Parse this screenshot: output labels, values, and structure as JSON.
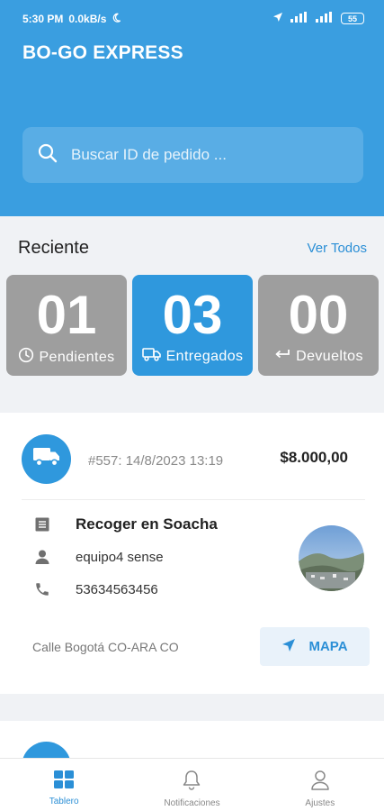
{
  "status_bar": {
    "time": "5:30 PM",
    "speed": "0.0kB/s",
    "battery": "55"
  },
  "header": {
    "title": "BO-GO EXPRESS"
  },
  "search": {
    "placeholder": "Buscar ID de pedido ..."
  },
  "recent": {
    "title": "Reciente",
    "view_all": "Ver Todos",
    "tiles": [
      {
        "count": "01",
        "label": "Pendientes",
        "icon": "clock-icon",
        "active": false
      },
      {
        "count": "03",
        "label": "Entregados",
        "icon": "truck-icon",
        "active": true
      },
      {
        "count": "00",
        "label": "Devueltos",
        "icon": "return-arrow-icon",
        "active": false
      }
    ]
  },
  "order": {
    "id_date": "#557: 14/8/2023 13:19",
    "amount": "$8.000,00",
    "title": "Recoger en Soacha",
    "customer": "equipo4 sense",
    "phone": "53634563456",
    "address": "Calle Bogotá CO-ARA CO",
    "map_button": "MAPA"
  },
  "bottom_nav": [
    {
      "label": "Tablero",
      "icon": "dashboard-grid-icon",
      "active": true
    },
    {
      "label": "Notificaciones",
      "icon": "bell-icon",
      "active": false
    },
    {
      "label": "Ajustes",
      "icon": "person-icon",
      "active": false
    }
  ],
  "colors": {
    "primary": "#3a9ee0",
    "accent": "#2f98dd",
    "tile_inactive": "#9e9e9e",
    "background": "#f0f2f5"
  }
}
